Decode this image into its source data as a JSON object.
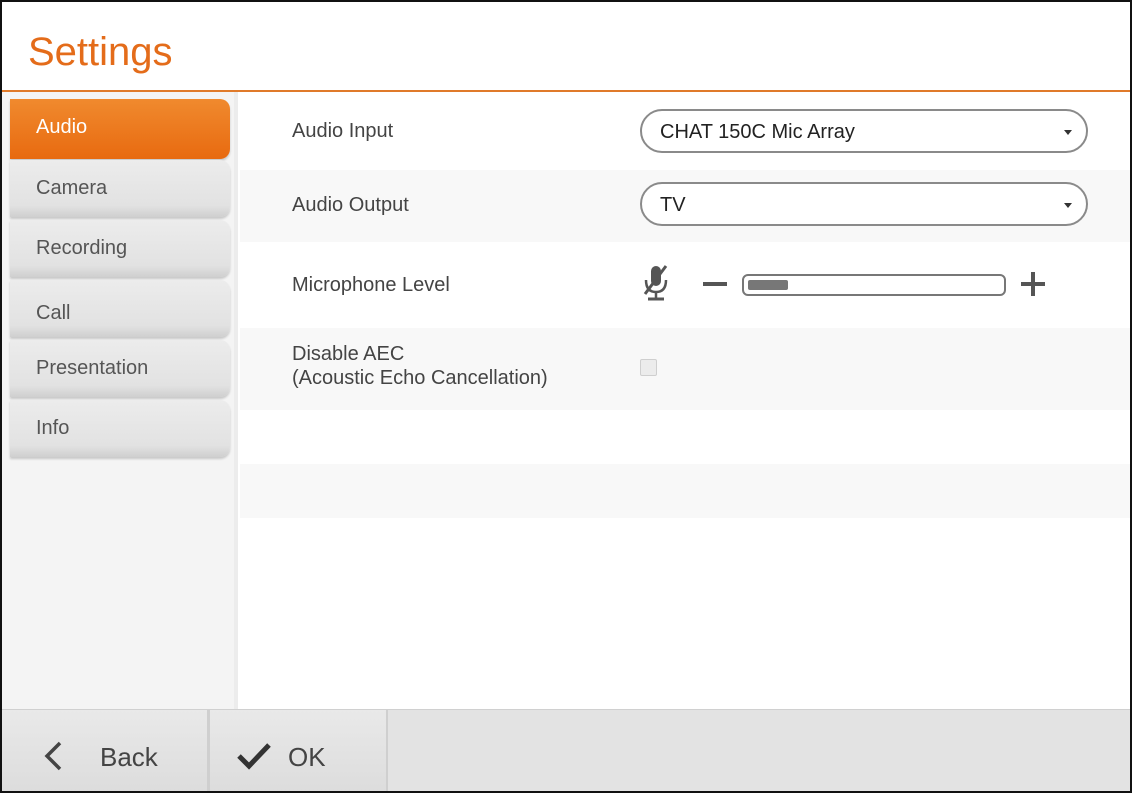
{
  "header": {
    "title": "Settings"
  },
  "sidebar": {
    "items": [
      {
        "label": "Audio",
        "active": true
      },
      {
        "label": "Camera"
      },
      {
        "label": "Recording"
      },
      {
        "label": "Call"
      },
      {
        "label": "Presentation"
      },
      {
        "label": "Info"
      }
    ]
  },
  "audio": {
    "input": {
      "label": "Audio Input",
      "value": "CHAT 150C Mic Array"
    },
    "output": {
      "label": "Audio Output",
      "value": "TV"
    },
    "mic_level": {
      "label": "Microphone Level",
      "level_fraction": 0.16,
      "muted_icon": "mic-muted-icon"
    },
    "disable_aec": {
      "label_line1": "Disable AEC",
      "label_line2": "(Acoustic Echo Cancellation)",
      "checked": false
    }
  },
  "footer": {
    "back_label": "Back",
    "ok_label": "OK"
  },
  "colors": {
    "accent": "#e86a10",
    "title": "#e46c1a"
  }
}
